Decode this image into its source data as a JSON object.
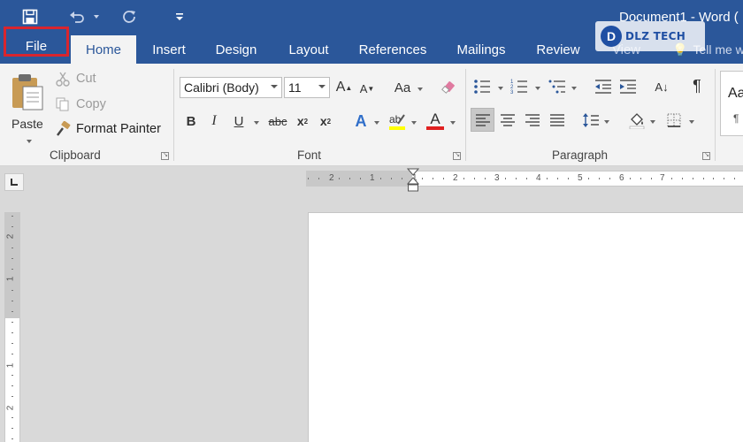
{
  "app": {
    "document_title": "Document1 - Word (",
    "watermark_text": "DLZ TECH",
    "watermark_logo_letter": "D"
  },
  "tabs": [
    {
      "label": "File"
    },
    {
      "label": "Home"
    },
    {
      "label": "Insert"
    },
    {
      "label": "Design"
    },
    {
      "label": "Layout"
    },
    {
      "label": "References"
    },
    {
      "label": "Mailings"
    },
    {
      "label": "Review"
    },
    {
      "label": "View"
    }
  ],
  "tell_me": "Tell me w",
  "clipboard": {
    "paste_label": "Paste",
    "cut_label": "Cut",
    "copy_label": "Copy",
    "format_painter_label": "Format Painter",
    "group_label": "Clipboard"
  },
  "font": {
    "font_name": "Calibri (Body)",
    "font_size": "11",
    "grow_label": "A",
    "shrink_label": "A",
    "case_label": "Aa",
    "bold_label": "B",
    "italic_label": "I",
    "underline_label": "U",
    "strike_label": "abc",
    "subscript_label": "x",
    "superscript_label": "x",
    "effects_label": "A",
    "font_color_label": "A",
    "group_label": "Font"
  },
  "paragraph": {
    "group_label": "Paragraph",
    "sort_label": "A↓",
    "pilcrow_label": "¶"
  },
  "styles": {
    "preview_text": "Aa",
    "preview_mark": "¶"
  },
  "colors": {
    "word_blue": "#2b579a",
    "highlight_red": "#d9252e",
    "font_color_red": "#e02020"
  },
  "ruler": {
    "horizontal_numbers": [
      "2",
      "1",
      "1",
      "2",
      "3",
      "4",
      "5",
      "6",
      "7"
    ],
    "vertical_numbers": [
      "2",
      "1",
      "1",
      "2"
    ]
  }
}
